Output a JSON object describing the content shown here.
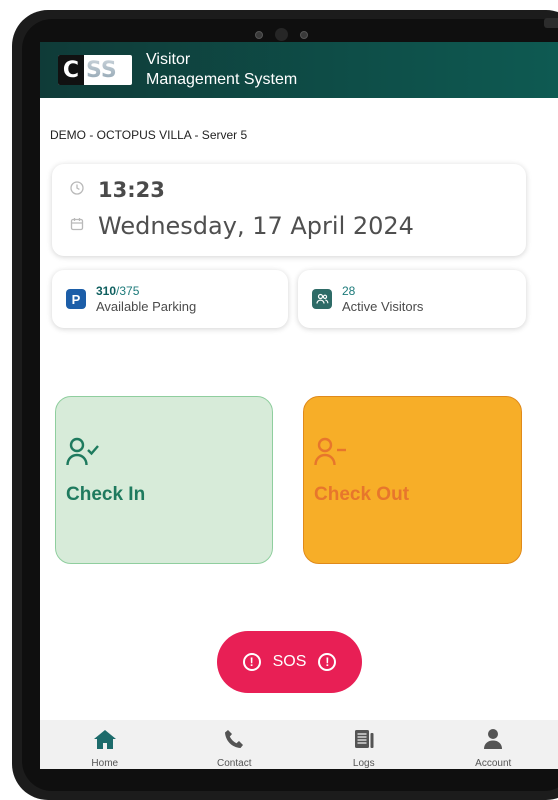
{
  "app": {
    "logo_text": "CSS",
    "title_line1": "Visitor",
    "title_line2": "Management System"
  },
  "site_label": "DEMO - OCTOPUS VILLA - Server 5",
  "clock": {
    "time": "13:23",
    "date": "Wednesday, 17 April 2024"
  },
  "stats": {
    "parking": {
      "available": "310",
      "total": "/375",
      "label": "Available Parking",
      "badge": "P"
    },
    "visitors": {
      "count": "28",
      "label": "Active Visitors"
    }
  },
  "actions": {
    "check_in": "Check In",
    "check_out": "Check Out"
  },
  "sos": {
    "label": "SOS"
  },
  "nav": [
    {
      "label": "Home",
      "icon": "home-icon",
      "active": true
    },
    {
      "label": "Contact",
      "icon": "phone-icon",
      "active": false
    },
    {
      "label": "Logs",
      "icon": "logs-icon",
      "active": false
    },
    {
      "label": "Account",
      "icon": "user-icon",
      "active": false
    }
  ],
  "colors": {
    "header": "#0e5a52",
    "accent_teal": "#1c7a7a",
    "check_in_bg": "#d7ebd9",
    "check_out_bg": "#f7ae28",
    "sos": "#e81f55"
  }
}
